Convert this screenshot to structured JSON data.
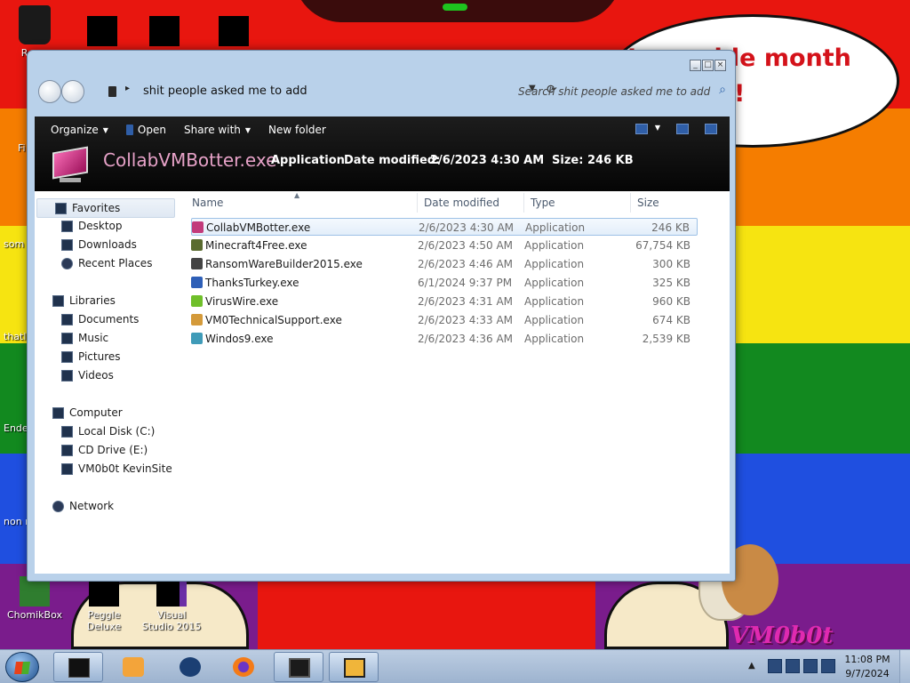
{
  "desktop": {
    "speech_text_line1": "L... ... ide month",
    "speech_text_line2": "!",
    "icons": [
      {
        "label": "Rec..."
      },
      {
        "label": "ChomikBox"
      },
      {
        "label": "Peggle Deluxe"
      },
      {
        "label": "Visual Studio 2015"
      }
    ],
    "edge_labels": [
      "Fi",
      "som ra",
      "thatl",
      "Ende",
      "non retar"
    ],
    "logo_text": "VM0b0t"
  },
  "explorer": {
    "address": {
      "path": "shit people asked me to add"
    },
    "search": {
      "placeholder": "Search shit people asked me to add"
    },
    "toolbar": {
      "organize": "Organize",
      "open": "Open",
      "share_with": "Share with",
      "new_folder": "New folder"
    },
    "details": {
      "name": "CollabVMBotter.exe",
      "type": "Application",
      "date_label": "Date modified:",
      "date_value": "2/6/2023 4:30 AM",
      "size_label": "Size:",
      "size_value": "246 KB"
    },
    "nav": {
      "favorites": "Favorites",
      "desktop": "Desktop",
      "downloads": "Downloads",
      "recent_places": "Recent Places",
      "libraries": "Libraries",
      "documents": "Documents",
      "music": "Music",
      "pictures": "Pictures",
      "videos": "Videos",
      "computer": "Computer",
      "local_disk": "Local Disk (C:)",
      "cd_drive": "CD Drive (E:)",
      "vm_site": "VM0b0t KevinSite",
      "network": "Network"
    },
    "columns": {
      "name": "Name",
      "date": "Date modified",
      "type": "Type",
      "size": "Size"
    },
    "files": [
      {
        "name": "CollabVMBotter.exe",
        "date": "2/6/2023 4:30 AM",
        "type": "Application",
        "size": "246 KB",
        "icon_color": "#c23b7b",
        "selected": true
      },
      {
        "name": "Minecraft4Free.exe",
        "date": "2/6/2023 4:50 AM",
        "type": "Application",
        "size": "67,754 KB",
        "icon_color": "#5a6b2f"
      },
      {
        "name": "RansomWareBuilder2015.exe",
        "date": "2/6/2023 4:46 AM",
        "type": "Application",
        "size": "300 KB",
        "icon_color": "#444444"
      },
      {
        "name": "ThanksTurkey.exe",
        "date": "6/1/2024 9:37 PM",
        "type": "Application",
        "size": "325 KB",
        "icon_color": "#2e5fb7"
      },
      {
        "name": "VirusWire.exe",
        "date": "2/6/2023 4:31 AM",
        "type": "Application",
        "size": "960 KB",
        "icon_color": "#6fbf2a"
      },
      {
        "name": "VM0TechnicalSupport.exe",
        "date": "2/6/2023 4:33 AM",
        "type": "Application",
        "size": "674 KB",
        "icon_color": "#d49a3a"
      },
      {
        "name": "Windos9.exe",
        "date": "2/6/2023 4:36 AM",
        "type": "Application",
        "size": "2,539 KB",
        "icon_color": "#3f9bb8"
      }
    ]
  },
  "taskbar": {
    "time": "11:08 PM",
    "date": "9/7/2024",
    "pinned": [
      "cmd-icon",
      "media-player-icon",
      "globe-icon",
      "firefox-icon",
      "computer-icon",
      "de-icon"
    ]
  }
}
